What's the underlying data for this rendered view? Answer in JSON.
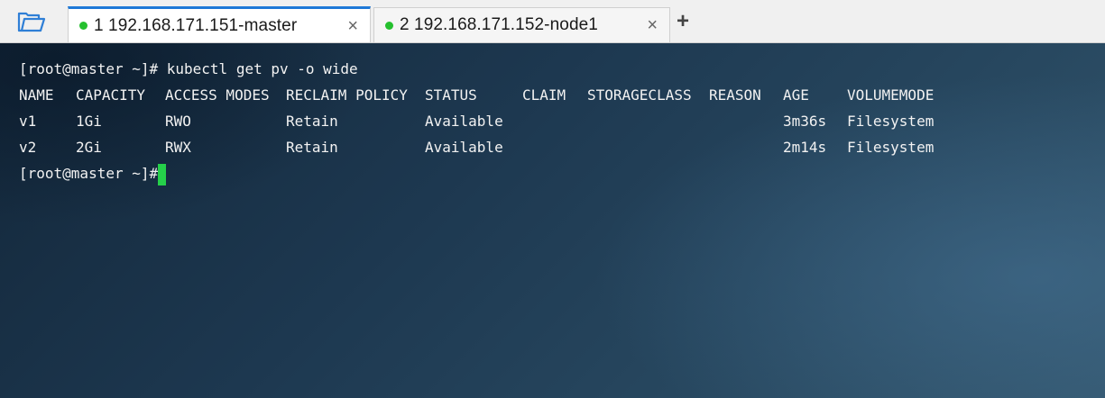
{
  "tabs": [
    {
      "label": "1 192.168.171.151-master",
      "status_color": "#25c02e",
      "active": true
    },
    {
      "label": "2 192.168.171.152-node1",
      "status_color": "#25c02e",
      "active": false
    }
  ],
  "tab_close_glyph": "×",
  "add_tab_glyph": "+",
  "icons": {
    "open_folder": "folder-open-icon"
  },
  "terminal": {
    "command_line": "[root@master ~]# kubectl get pv -o wide",
    "headers": [
      "NAME",
      "CAPACITY",
      "ACCESS MODES",
      "RECLAIM POLICY",
      "STATUS",
      "CLAIM",
      "STORAGECLASS",
      "REASON",
      "AGE",
      "VOLUMEMODE"
    ],
    "rows": [
      [
        "v1",
        "1Gi",
        "RWO",
        "Retain",
        "Available",
        "",
        "",
        "",
        "3m36s",
        "Filesystem"
      ],
      [
        "v2",
        "2Gi",
        "RWX",
        "Retain",
        "Available",
        "",
        "",
        "",
        "2m14s",
        "Filesystem"
      ]
    ],
    "prompt": "[root@master ~]#",
    "cursor_color": "#25d04a"
  }
}
